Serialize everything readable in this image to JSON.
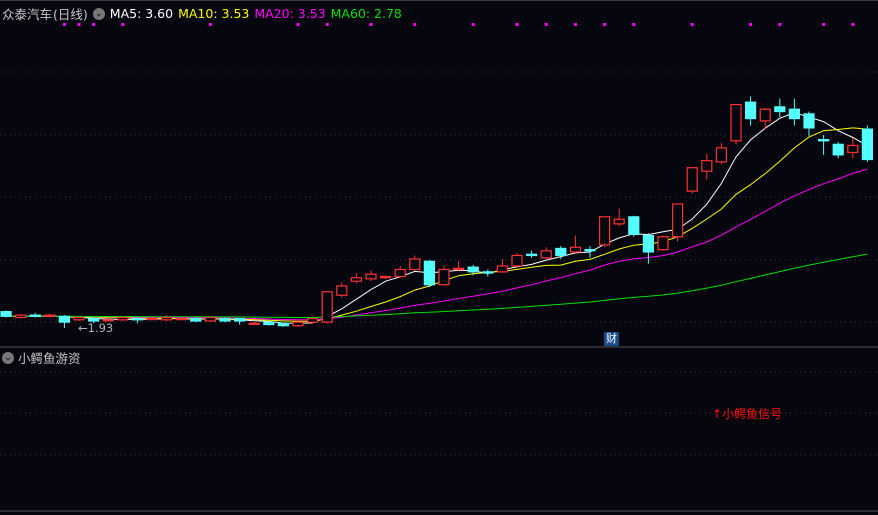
{
  "header": {
    "stock_name": "众泰汽车",
    "period": "(日线)",
    "ma5": "MA5: 3.60",
    "ma10": "MA10: 3.53",
    "ma20": "MA20: 3.53",
    "ma60": "MA60: 2.78"
  },
  "sub_panel": {
    "title": "小鳄鱼游资",
    "signal_label": "小鳄鱼信号"
  },
  "badge": "财",
  "low_marker": "←1.93",
  "colors": {
    "up": "#ff3232",
    "down": "#54ffff",
    "ma5": "#ffffff",
    "ma10": "#ffff00",
    "ma20": "#ff00ff",
    "ma60": "#00e000",
    "marker": "#ff00ff"
  },
  "chart_data": {
    "type": "candlestick",
    "ma_periods": [
      5,
      10,
      20,
      60
    ],
    "ylim": [
      1.93,
      3.91
    ],
    "candles": [
      [
        2.07,
        2.03,
        2.08,
        2.02
      ],
      [
        2.02,
        2.04,
        2.05,
        2.01
      ],
      [
        2.04,
        2.03,
        2.06,
        2.02
      ],
      [
        2.03,
        2.04,
        2.05,
        2.02
      ],
      [
        2.03,
        1.98,
        2.04,
        1.93
      ],
      [
        2.0,
        2.02,
        2.03,
        1.99
      ],
      [
        2.01,
        1.99,
        2.02,
        1.97
      ],
      [
        2.0,
        2.0,
        2.01,
        1.99
      ],
      [
        2.0,
        2.02,
        2.03,
        1.99
      ],
      [
        2.01,
        2.0,
        2.02,
        1.97
      ],
      [
        2.01,
        2.01,
        2.02,
        2.0
      ],
      [
        2.0,
        2.02,
        2.04,
        1.99
      ],
      [
        2.01,
        2.01,
        2.02,
        2.0
      ],
      [
        2.01,
        1.99,
        2.02,
        1.98
      ],
      [
        1.99,
        2.02,
        2.03,
        1.98
      ],
      [
        2.01,
        1.99,
        2.02,
        1.98
      ],
      [
        2.01,
        1.99,
        2.01,
        1.96
      ],
      [
        1.97,
        1.97,
        1.98,
        1.96
      ],
      [
        1.98,
        1.96,
        1.99,
        1.95
      ],
      [
        1.97,
        1.95,
        1.97,
        1.94
      ],
      [
        1.95,
        1.98,
        2.0,
        1.94
      ],
      [
        1.98,
        2.01,
        2.03,
        1.97
      ],
      [
        1.98,
        2.24,
        2.24,
        1.97
      ],
      [
        2.21,
        2.29,
        2.32,
        2.19
      ],
      [
        2.33,
        2.36,
        2.4,
        2.31
      ],
      [
        2.35,
        2.39,
        2.42,
        2.33
      ],
      [
        2.36,
        2.37,
        2.38,
        2.35
      ],
      [
        2.37,
        2.43,
        2.46,
        2.36
      ],
      [
        2.43,
        2.52,
        2.55,
        2.42
      ],
      [
        2.5,
        2.3,
        2.51,
        2.28
      ],
      [
        2.3,
        2.43,
        2.46,
        2.3
      ],
      [
        2.43,
        2.44,
        2.5,
        2.42
      ],
      [
        2.45,
        2.41,
        2.47,
        2.38
      ],
      [
        2.41,
        2.4,
        2.43,
        2.37
      ],
      [
        2.41,
        2.46,
        2.52,
        2.4
      ],
      [
        2.46,
        2.55,
        2.57,
        2.45
      ],
      [
        2.56,
        2.55,
        2.59,
        2.53
      ],
      [
        2.53,
        2.59,
        2.62,
        2.52
      ],
      [
        2.61,
        2.55,
        2.63,
        2.52
      ],
      [
        2.58,
        2.62,
        2.72,
        2.57
      ],
      [
        2.6,
        2.59,
        2.63,
        2.53
      ],
      [
        2.64,
        2.88,
        2.88,
        2.62
      ],
      [
        2.82,
        2.86,
        2.95,
        2.8
      ],
      [
        2.88,
        2.73,
        2.89,
        2.71
      ],
      [
        2.72,
        2.58,
        2.74,
        2.48
      ],
      [
        2.6,
        2.71,
        2.72,
        2.59
      ],
      [
        2.71,
        2.99,
        2.99,
        2.67
      ],
      [
        3.1,
        3.3,
        3.3,
        3.08
      ],
      [
        3.27,
        3.36,
        3.42,
        3.2
      ],
      [
        3.35,
        3.47,
        3.51,
        3.33
      ],
      [
        3.53,
        3.84,
        3.84,
        3.5
      ],
      [
        3.86,
        3.72,
        3.91,
        3.66
      ],
      [
        3.7,
        3.8,
        3.81,
        3.63
      ],
      [
        3.82,
        3.78,
        3.89,
        3.73
      ],
      [
        3.8,
        3.72,
        3.89,
        3.66
      ],
      [
        3.76,
        3.64,
        3.78,
        3.57
      ],
      [
        3.54,
        3.53,
        3.58,
        3.41
      ],
      [
        3.5,
        3.41,
        3.52,
        3.38
      ],
      [
        3.43,
        3.49,
        3.55,
        3.38
      ],
      [
        3.63,
        3.37,
        3.66,
        3.35
      ]
    ],
    "signal_markers": [
      4,
      5,
      6,
      8,
      14,
      20,
      22,
      25,
      28,
      32,
      35,
      37,
      39,
      41,
      43,
      47,
      51,
      53,
      56,
      58
    ]
  }
}
